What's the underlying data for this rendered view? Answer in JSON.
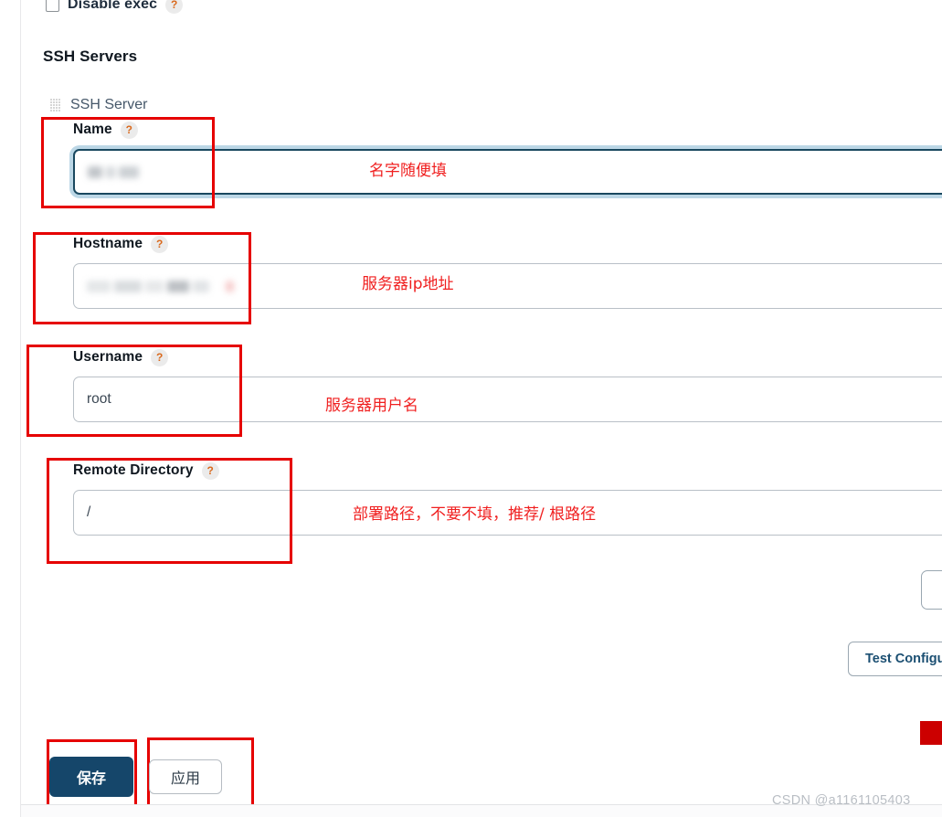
{
  "page": {
    "title": "SSH Servers",
    "watermark": "CSDN @a1161105403"
  },
  "top_checkbox": {
    "label": "Disable exec",
    "help": "?",
    "checked": false
  },
  "entity": {
    "name": "SSH Server",
    "grip_icon": "drag-grip-icon"
  },
  "fields": [
    {
      "key": "name",
      "label": "Name",
      "help": "?",
      "value": "",
      "value_redacted": true,
      "focused": true,
      "annotation": "名字随便填"
    },
    {
      "key": "hostname",
      "label": "Hostname",
      "help": "?",
      "value": "",
      "value_redacted": true,
      "focused": false,
      "annotation": "服务器ip地址"
    },
    {
      "key": "username",
      "label": "Username",
      "help": "?",
      "value": "root",
      "value_redacted": false,
      "focused": false,
      "annotation": "服务器用户名"
    },
    {
      "key": "remote_directory",
      "label": "Remote Directory",
      "help": "?",
      "value": "/",
      "value_redacted": false,
      "focused": false,
      "annotation": "部署路径，不要不填，推荐/ 根路径"
    }
  ],
  "right_controls": {
    "test_config_label": "Test Configu"
  },
  "footer": {
    "save_label": "保存",
    "apply_label": "应用"
  },
  "colors": {
    "annotation_red": "#f02020",
    "box_red": "#e60000",
    "save_blue": "#15466a",
    "focus_ring": "#bcd7e6",
    "focus_border": "#19485f",
    "link_blue": "#1b4f72"
  }
}
